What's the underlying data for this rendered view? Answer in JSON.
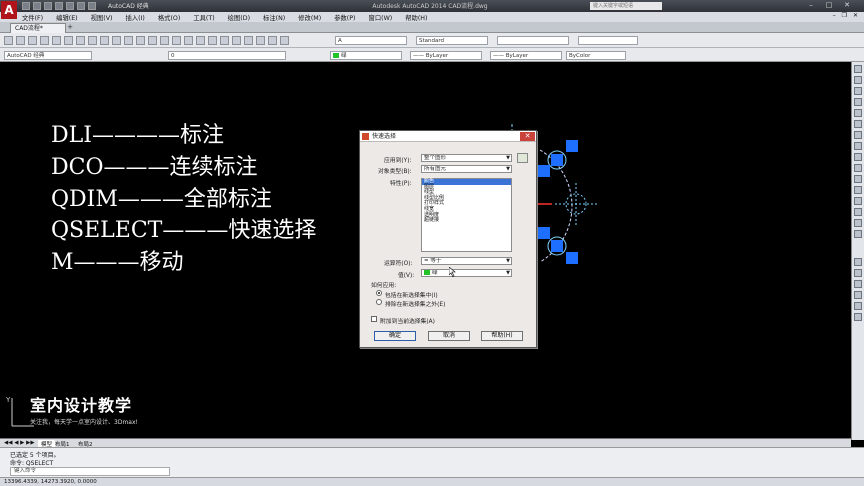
{
  "titlebar": {
    "title": "Autodesk AutoCAD 2014    CAD流程.dwg",
    "search_placeholder": "键入关键字或短语",
    "workspace": "AutoCAD 经典"
  },
  "menubar": {
    "items": [
      "文件(F)",
      "编辑(E)",
      "视图(V)",
      "插入(I)",
      "格式(O)",
      "工具(T)",
      "绘图(D)",
      "标注(N)",
      "修改(M)",
      "参数(P)",
      "窗口(W)",
      "帮助(H)"
    ]
  },
  "filetabs": {
    "active": "CAD流程*"
  },
  "toolbar1": {
    "textstyle": "A",
    "dimstyle": "Standard"
  },
  "toolbar2": {
    "workspace": "AutoCAD 经典",
    "layer": "0",
    "color": "绿",
    "linetype": "ByLayer",
    "lineweight": "ByLayer",
    "plotstyle": "ByColor"
  },
  "canvas": {
    "lines": [
      {
        "cmd": "DLI",
        "dash": "————",
        "desc": "标注"
      },
      {
        "cmd": "DCO",
        "dash": "———",
        "desc": "连续标注"
      },
      {
        "cmd": "QDIM",
        "dash": "———",
        "desc": "全部标注"
      },
      {
        "cmd": "QSELECT",
        "dash": "———",
        "desc": "快速选择"
      },
      {
        "cmd": "M",
        "dash": "———",
        "desc": "移动"
      }
    ],
    "watermark_title": "室内设计教学",
    "watermark_sub": "关注我，每天学一点室内设计、3Dmax!",
    "colors": {
      "grip": "#1e6fff",
      "text": "#ffffff",
      "background": "#000000"
    }
  },
  "dialog": {
    "title": "快速选择",
    "apply_to_label": "应用到(Y):",
    "apply_to_value": "整个图形",
    "object_type_label": "对象类型(B):",
    "object_type_value": "所有图元",
    "properties_label": "特性(P):",
    "properties": [
      "颜色",
      "图层",
      "线型",
      "线型比例",
      "打印样式",
      "线宽",
      "透明度",
      "超链接"
    ],
    "operator_label": "运算符(O):",
    "operator_value": "= 等于",
    "value_label": "值(V):",
    "value_value": "绿",
    "how_to_apply_label": "如何应用:",
    "radio_include": "包括在新选择集中(I)",
    "radio_exclude": "排除在新选择集之外(E)",
    "append_label": "附加到当前选择集(A)",
    "ok": "确定",
    "cancel": "取消",
    "help": "帮助(H)"
  },
  "layouttabs": {
    "model": "模型",
    "layout1": "布局1",
    "layout2": "布局2"
  },
  "cmdline": {
    "line1": "已选定 5 个项目。",
    "line2": "命令: QSELECT",
    "prompt": "键入命令"
  },
  "statusbar": {
    "coords": "13396.4339, 14273.3920, 0.0000"
  }
}
